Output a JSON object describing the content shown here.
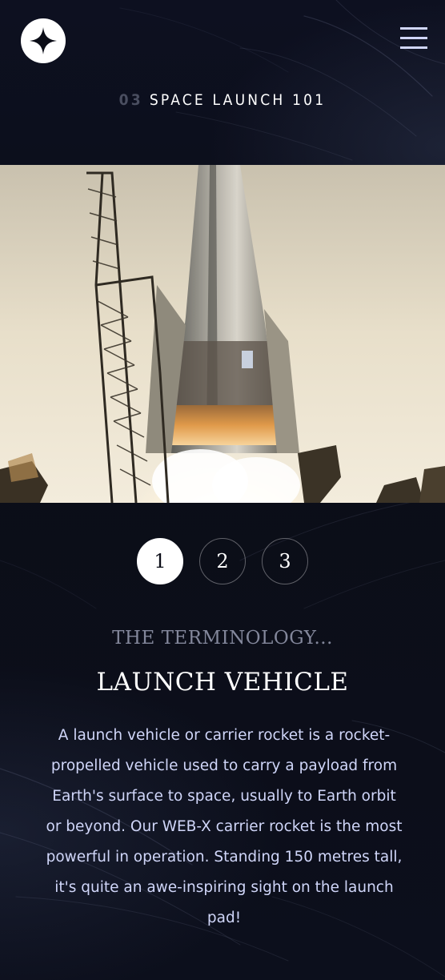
{
  "header": {
    "logo_icon": "star-icon",
    "menu_icon": "hamburger-icon"
  },
  "page": {
    "number": "03",
    "title": "SPACE LAUNCH 101"
  },
  "hero": {
    "image": "rocket-launch-photo"
  },
  "tabs": [
    {
      "label": "1",
      "active": true
    },
    {
      "label": "2",
      "active": false
    },
    {
      "label": "3",
      "active": false
    }
  ],
  "content": {
    "eyebrow": "THE TERMINOLOGY...",
    "title": "LAUNCH VEHICLE",
    "description": "A launch vehicle or carrier rocket is a rocket-propelled vehicle used to carry a payload from Earth's surface to space, usually to Earth orbit or beyond. Our WEB-X carrier rocket is the most powerful in operation. Standing 150 metres tall, it's quite an awe-inspiring sight on the launch pad!"
  },
  "colors": {
    "background": "#0b0d17",
    "text_muted": "#d0d6f9",
    "eyebrow": "#83879b"
  }
}
